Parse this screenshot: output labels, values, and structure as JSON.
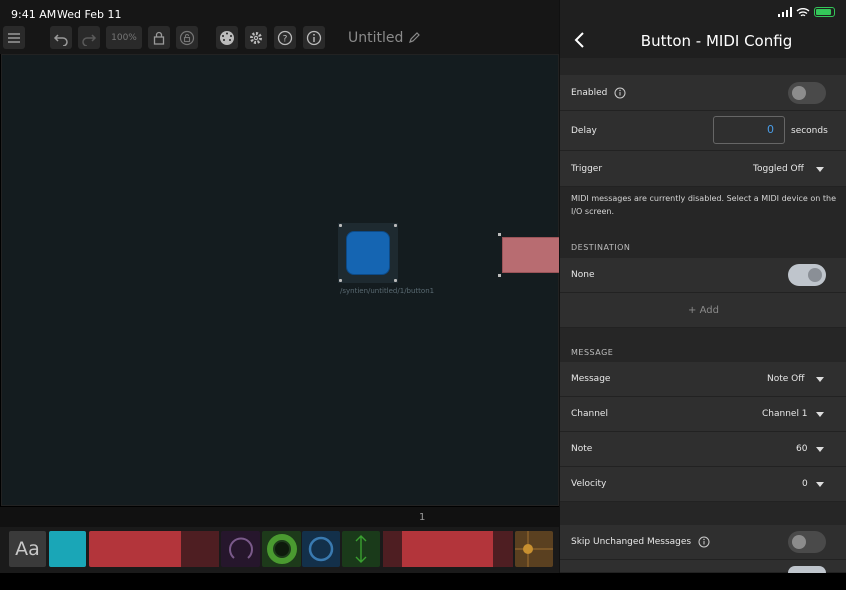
{
  "status_bar": {
    "time": "9:41 AM",
    "date": "Wed Feb 11"
  },
  "toolbar": {
    "zoom": "100%",
    "document_title": "Untitled",
    "icons": [
      "menu-icon",
      "undo-icon",
      "redo-icon",
      "lock-icon",
      "unlock-icon",
      "midi-icon",
      "gear-icon",
      "help-icon",
      "info-icon",
      "pencil-icon"
    ]
  },
  "canvas": {
    "selected_widget_path": "/syntien/untitled/1/button1",
    "selected_widget_color": "#1565b2"
  },
  "pagebar": {
    "page_number": "1"
  },
  "palette": {
    "text_tool_label": "Aa",
    "items": [
      "text",
      "button",
      "toggle",
      "knob",
      "encoder",
      "knob",
      "fader",
      "toggle",
      "xy-pad"
    ]
  },
  "panel": {
    "title": "Button - MIDI Config",
    "enabled": {
      "label": "Enabled",
      "value": false
    },
    "delay": {
      "label": "Delay",
      "value": "0",
      "unit": "seconds"
    },
    "trigger": {
      "label": "Trigger",
      "value": "Toggled Off"
    },
    "info_text": "MIDI messages are currently disabled. Select a MIDI device on the I/O screen.",
    "destination": {
      "header": "DESTINATION",
      "item_label": "None",
      "item_enabled": true,
      "add_label": "+ Add"
    },
    "message": {
      "header": "MESSAGE",
      "message": {
        "label": "Message",
        "value": "Note Off"
      },
      "channel": {
        "label": "Channel",
        "value": "Channel 1"
      },
      "note": {
        "label": "Note",
        "value": "60"
      },
      "velocity": {
        "label": "Velocity",
        "value": "0"
      }
    },
    "skip_unchanged": {
      "label": "Skip Unchanged Messages",
      "value": false
    }
  },
  "colors": {
    "accent_blue": "#4a9ce6",
    "battery_green": "#34c759",
    "canvas_bg": "#141c1f",
    "panel_bg": "#262626"
  }
}
